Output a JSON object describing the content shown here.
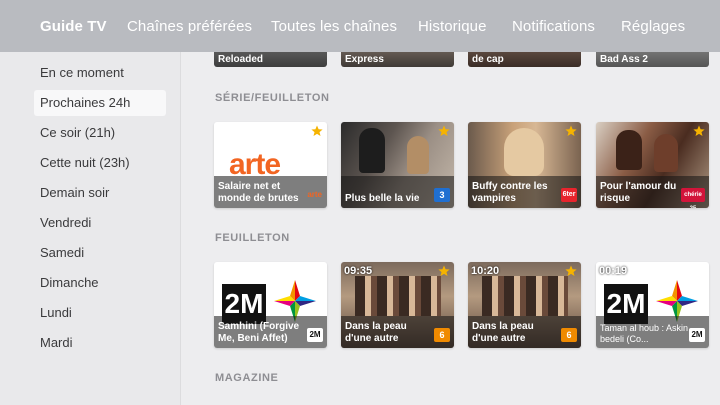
{
  "topbar": {
    "tabs": [
      {
        "label": "Guide TV",
        "active": true
      },
      {
        "label": "Chaînes préférées"
      },
      {
        "label": "Toutes les chaînes"
      },
      {
        "label": "Historique"
      },
      {
        "label": "Notifications"
      },
      {
        "label": "Réglages"
      }
    ]
  },
  "sidebar": {
    "items": [
      {
        "label": "En ce moment"
      },
      {
        "label": "Prochaines 24h",
        "selected": true
      },
      {
        "label": "Ce soir (21h)"
      },
      {
        "label": "Cette nuit (23h)"
      },
      {
        "label": "Demain soir"
      },
      {
        "label": "Vendredi"
      },
      {
        "label": "Samedi"
      },
      {
        "label": "Dimanche"
      },
      {
        "label": "Lundi"
      },
      {
        "label": "Mardi"
      }
    ]
  },
  "top_row": [
    {
      "title": "Reloaded"
    },
    {
      "title": "Express"
    },
    {
      "title": "de cap"
    },
    {
      "title": "Bad Ass 2"
    }
  ],
  "sections": [
    {
      "title": "SÉRIE/FEUILLETON",
      "cards": [
        {
          "title": "Salaire net et monde de brutes",
          "channel": "arte",
          "starred": true,
          "logo_text": "arte"
        },
        {
          "title": "Plus belle la vie",
          "channel": "3",
          "starred": true
        },
        {
          "title": "Buffy contre les vampires",
          "channel": "6ter",
          "starred": true
        },
        {
          "title": "Pour l'amour du risque",
          "channel": "chérie 25",
          "starred": true
        }
      ]
    },
    {
      "title": "FEUILLETON",
      "cards": [
        {
          "title": "Samhini (Forgive Me, Beni Affet)",
          "channel": "2M",
          "starred": false,
          "logo_text": "2M"
        },
        {
          "title": "Dans la peau d'une autre",
          "time": "09:35",
          "channel": "6",
          "starred": true
        },
        {
          "title": "Dans la peau d'une autre",
          "time": "10:20",
          "channel": "6",
          "starred": true
        },
        {
          "title": "Taman al houb : Askin bedeli (Co...",
          "time": "00:19",
          "channel": "2M",
          "starred": false,
          "logo_text": "2M"
        }
      ]
    },
    {
      "title": "MAGAZINE",
      "cards": []
    }
  ],
  "colors": {
    "star": "#f5b301",
    "arte_orange": "#f26522",
    "france3_blue": "#1f6fd1",
    "m6_orange": "#f08a00"
  }
}
